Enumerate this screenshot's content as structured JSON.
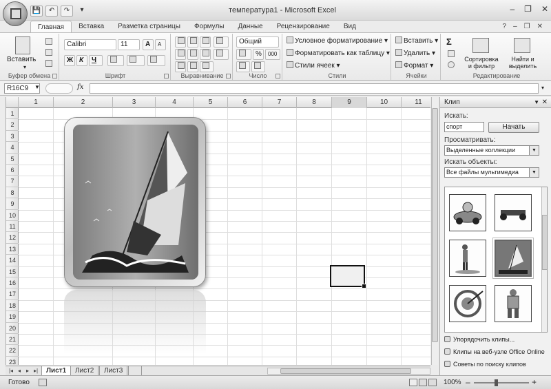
{
  "window": {
    "title": "температура1 - Microsoft Excel",
    "controls": [
      "–",
      "❐",
      "✕"
    ]
  },
  "ribbon_controls": [
    "?",
    "–",
    "❐",
    "✕"
  ],
  "quick_access": [
    "💾",
    "↶",
    "↷",
    "▾"
  ],
  "tabs": [
    "Главная",
    "Вставка",
    "Разметка страницы",
    "Формулы",
    "Данные",
    "Рецензирование",
    "Вид"
  ],
  "active_tab": "Главная",
  "ribbon": {
    "clipboard": {
      "label": "Буфер обмена",
      "paste": "Вставить"
    },
    "font": {
      "label": "Шрифт",
      "font_name": "Calibri",
      "font_size": "11",
      "bold": "Ж",
      "italic": "К",
      "underline": "Ч",
      "grow": "A",
      "shrink": "A"
    },
    "alignment": {
      "label": "Выравнивание"
    },
    "number": {
      "label": "Число",
      "format": "Общий",
      "percent": "%",
      "thousands": "000"
    },
    "styles": {
      "label": "Стили",
      "conditional": "Условное форматирование",
      "as_table": "Форматировать как таблицу",
      "cell_styles": "Стили ячеек"
    },
    "cells": {
      "label": "Ячейки",
      "insert": "Вставить",
      "delete": "Удалить",
      "format": "Формат"
    },
    "editing": {
      "label": "Редактирование",
      "sum": "Σ",
      "sort_line1": "Сортировка",
      "sort_line2": "и фильтр",
      "find_line1": "Найти и",
      "find_line2": "выделить"
    }
  },
  "formula_bar": {
    "name_box": "R16C9",
    "fx": "fx",
    "value": ""
  },
  "columns": [
    "1",
    "2",
    "3",
    "4",
    "5",
    "6",
    "7",
    "8",
    "9",
    "10",
    "11"
  ],
  "selected_column": "9",
  "rows": [
    "1",
    "2",
    "3",
    "4",
    "5",
    "6",
    "7",
    "8",
    "9",
    "10",
    "11",
    "12",
    "13",
    "14",
    "15",
    "16",
    "17",
    "18",
    "19",
    "20",
    "21",
    "22",
    "23"
  ],
  "sheets": [
    "Лист1",
    "Лист2",
    "Лист3"
  ],
  "active_sheet": "Лист1",
  "sheet_nav": [
    "|◂",
    "◂",
    "▸",
    "▸|"
  ],
  "status": {
    "text": "Готово",
    "zoom": "100%",
    "zoom_out": "–",
    "zoom_in": "+"
  },
  "task_pane": {
    "title": "Клип",
    "search_label": "Искать:",
    "search_value": "спорт",
    "search_button": "Начать",
    "browse_label": "Просматривать:",
    "browse_value": "Выделенные коллекции",
    "types_label": "Искать объекты:",
    "types_value": "Все файлы мультимедиа",
    "links": [
      "Упорядочить клипы...",
      "Клипы на веб-узле Office Online",
      "Советы по поиску клипов"
    ]
  }
}
